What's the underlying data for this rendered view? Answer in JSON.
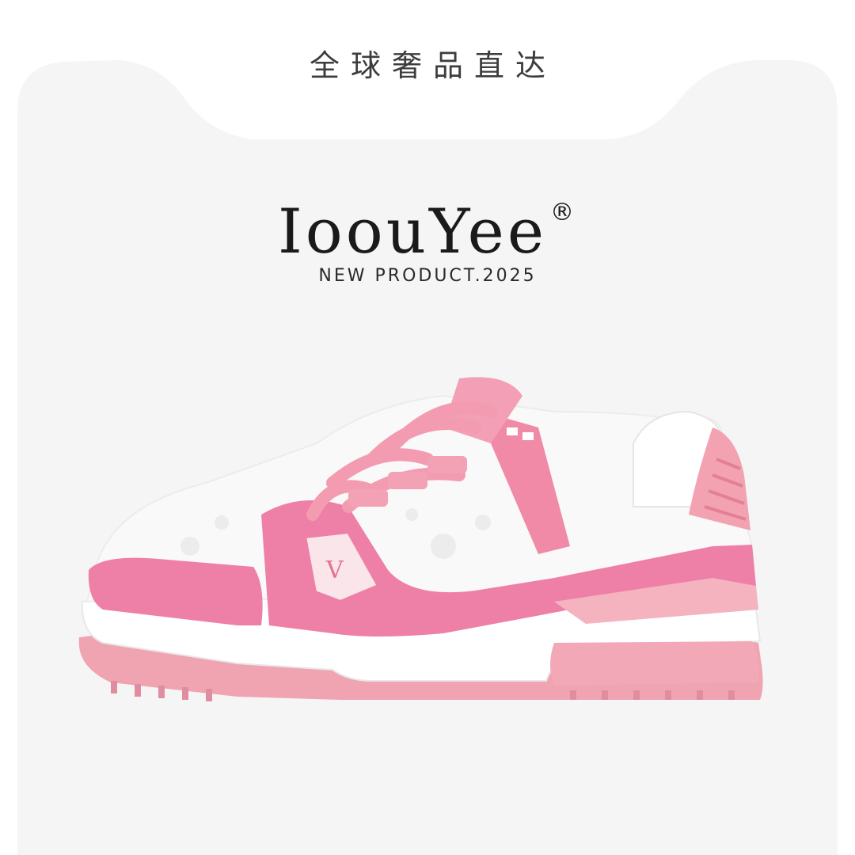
{
  "header": {
    "tagline": "全球奢品直达"
  },
  "brand": {
    "name": "IoouYee",
    "registered_mark": "®",
    "subline": "NEW  PRODUCT.2025"
  },
  "product": {
    "icon": "pink-white-low-top-sneaker-image",
    "colors": {
      "background": "#f5f5f5",
      "pink": "#ef86a8",
      "light_pink": "#f3a9b6",
      "white": "#ffffff"
    }
  }
}
